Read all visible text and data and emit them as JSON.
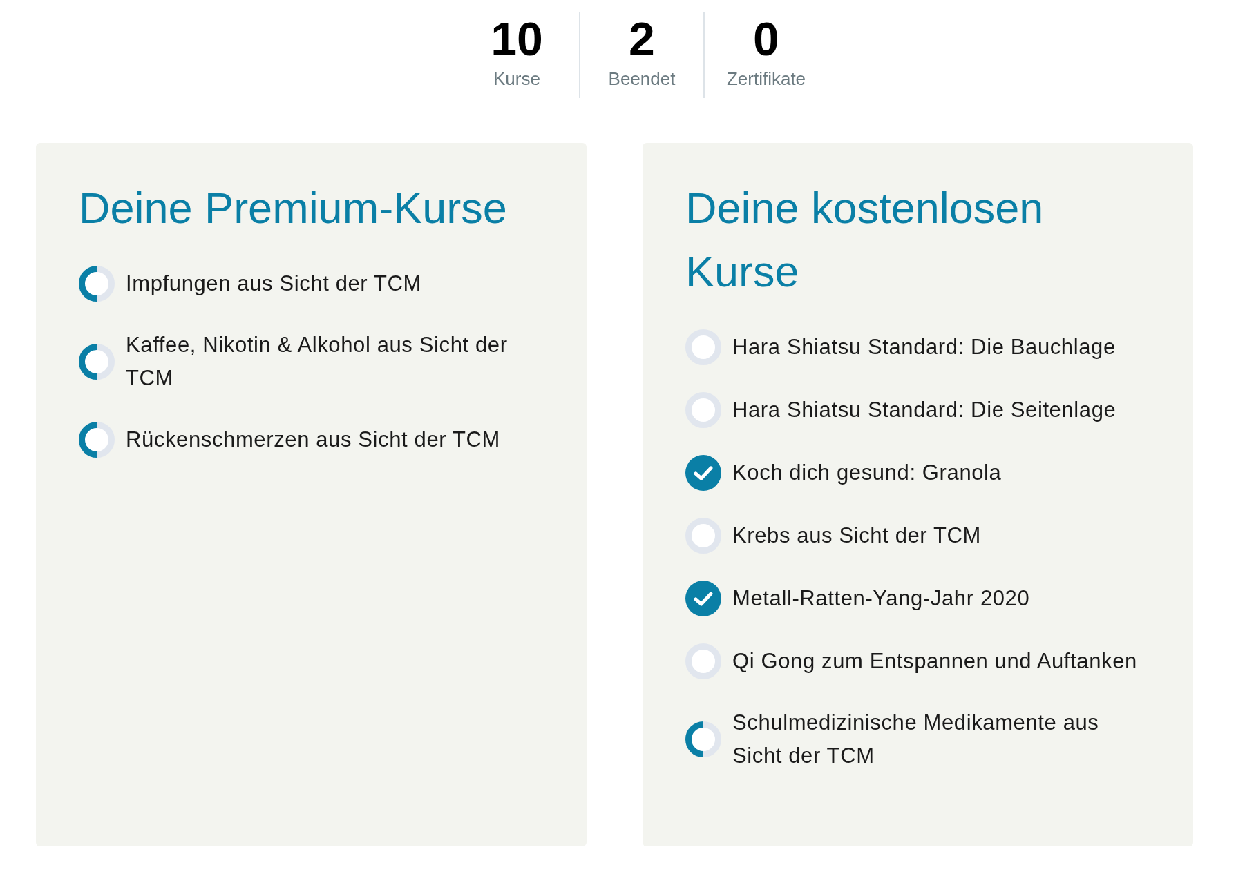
{
  "stats": [
    {
      "value": "10",
      "label": "Kurse"
    },
    {
      "value": "2",
      "label": "Beendet"
    },
    {
      "value": "0",
      "label": "Zertifikate"
    }
  ],
  "premium": {
    "title": "Deine Premium-Kurse",
    "courses": [
      {
        "title": "Impfungen aus Sicht der TCM",
        "kind": "progress"
      },
      {
        "title": "Kaffee, Nikotin & Alkohol aus Sicht der TCM",
        "kind": "progress"
      },
      {
        "title": "Rückenschmerzen aus Sicht der TCM",
        "kind": "progress"
      }
    ]
  },
  "free": {
    "title": "Deine kostenlosen Kurse",
    "courses": [
      {
        "title": "Hara Shiatsu Standard: Die Bauchlage",
        "kind": "open"
      },
      {
        "title": "Hara Shiatsu Standard: Die Seitenlage",
        "kind": "open"
      },
      {
        "title": "Koch dich gesund: Granola",
        "kind": "done"
      },
      {
        "title": "Krebs aus Sicht der TCM",
        "kind": "open"
      },
      {
        "title": "Metall-Ratten-Yang-Jahr 2020",
        "kind": "done"
      },
      {
        "title": "Qi Gong zum Entspannen und Auftanken",
        "kind": "open"
      },
      {
        "title": "Schulmedizinische Medikamente aus Sicht der TCM",
        "kind": "progress"
      }
    ]
  }
}
